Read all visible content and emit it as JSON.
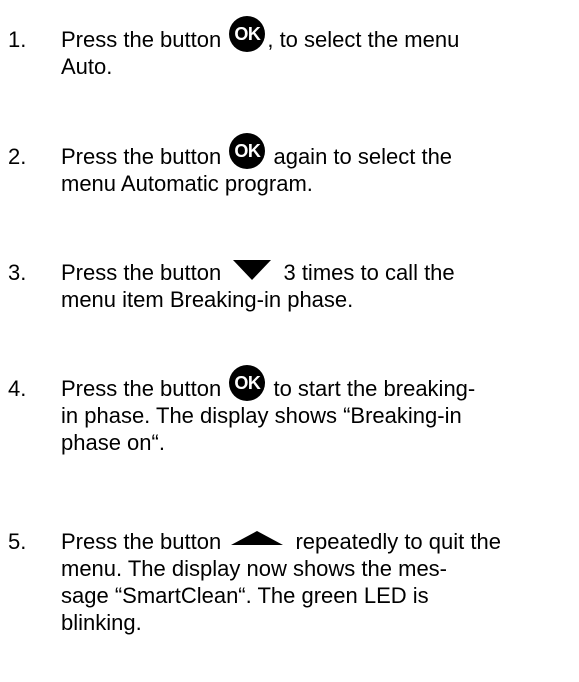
{
  "steps": [
    {
      "number": "1.",
      "icon": "ok-button-icon",
      "lines": [
        {
          "before": "Press the button",
          "icon_text": "OK",
          "after": ", to select the menu"
        },
        {
          "text": "Auto."
        }
      ]
    },
    {
      "number": "2.",
      "icon": "ok-button-icon",
      "lines": [
        {
          "before": "Press the button",
          "icon_text": "OK",
          "after": "again to select the"
        },
        {
          "text": "menu Automatic program."
        }
      ]
    },
    {
      "number": "3.",
      "icon": "down-arrow-icon",
      "lines": [
        {
          "before": "Press the button",
          "after": "3 times to call the"
        },
        {
          "text": "menu item Breaking-in phase."
        }
      ]
    },
    {
      "number": "4.",
      "icon": "ok-button-icon",
      "lines": [
        {
          "before": "Press the button",
          "icon_text": "OK",
          "after": "to start the breaking-"
        },
        {
          "text": "in phase. The display shows “Breaking-in"
        },
        {
          "text": "phase on“."
        }
      ]
    },
    {
      "number": "5.",
      "icon": "up-arrow-icon",
      "lines": [
        {
          "before": "Press the button",
          "after": "repeatedly to quit the"
        },
        {
          "text": "menu. The display now shows the mes-"
        },
        {
          "text": "sage “SmartClean“. The green LED is"
        },
        {
          "text": "blinking."
        }
      ]
    }
  ]
}
